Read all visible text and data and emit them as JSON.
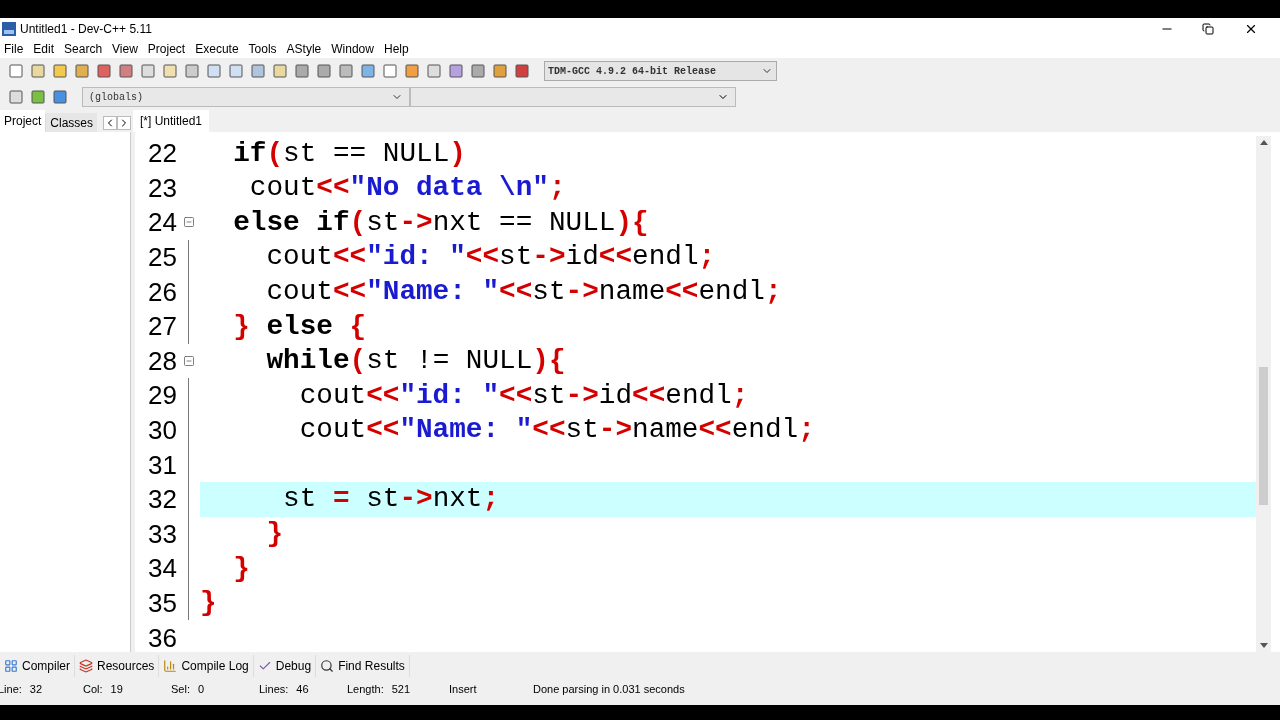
{
  "window": {
    "title": "Untitled1 - Dev-C++ 5.11"
  },
  "menu": [
    "File",
    "Edit",
    "Search",
    "View",
    "Project",
    "Execute",
    "Tools",
    "AStyle",
    "Window",
    "Help"
  ],
  "compiler_select": {
    "value": "TDM-GCC 4.9.2 64-bit Release"
  },
  "scope_select": {
    "value": "(globals)"
  },
  "side_tabs": [
    {
      "label": "Project",
      "selected": true
    },
    {
      "label": "Classes",
      "selected": false
    }
  ],
  "editor_tabs": [
    {
      "label": "[*] Untitled1",
      "selected": true
    }
  ],
  "lines": [
    {
      "number": "22",
      "fold": false,
      "current": false,
      "tokens": [
        {
          "kind": "keyword",
          "text": "  if"
        },
        {
          "kind": "operator",
          "text": "("
        },
        {
          "kind": "plain",
          "text": "st == NULL"
        },
        {
          "kind": "operator",
          "text": ")"
        }
      ]
    },
    {
      "number": "23",
      "fold": false,
      "current": false,
      "tokens": [
        {
          "kind": "plain",
          "text": "   cout"
        },
        {
          "kind": "operator",
          "text": "<<"
        },
        {
          "kind": "string",
          "text": "\"No data \\n\""
        },
        {
          "kind": "operator",
          "text": ";"
        }
      ]
    },
    {
      "number": "24",
      "fold": true,
      "current": false,
      "tokens": [
        {
          "kind": "keyword",
          "text": "  else if"
        },
        {
          "kind": "operator",
          "text": "("
        },
        {
          "kind": "plain",
          "text": "st"
        },
        {
          "kind": "operator",
          "text": "->"
        },
        {
          "kind": "plain",
          "text": "nxt == NULL"
        },
        {
          "kind": "operator",
          "text": "){"
        }
      ]
    },
    {
      "number": "25",
      "fold": false,
      "current": false,
      "tokens": [
        {
          "kind": "plain",
          "text": "    cout"
        },
        {
          "kind": "operator",
          "text": "<<"
        },
        {
          "kind": "string",
          "text": "\"id: \""
        },
        {
          "kind": "operator",
          "text": "<<"
        },
        {
          "kind": "plain",
          "text": "st"
        },
        {
          "kind": "operator",
          "text": "->"
        },
        {
          "kind": "plain",
          "text": "id"
        },
        {
          "kind": "operator",
          "text": "<<"
        },
        {
          "kind": "plain",
          "text": "endl"
        },
        {
          "kind": "operator",
          "text": ";"
        }
      ]
    },
    {
      "number": "26",
      "fold": false,
      "current": false,
      "tokens": [
        {
          "kind": "plain",
          "text": "    cout"
        },
        {
          "kind": "operator",
          "text": "<<"
        },
        {
          "kind": "string",
          "text": "\"Name: \""
        },
        {
          "kind": "operator",
          "text": "<<"
        },
        {
          "kind": "plain",
          "text": "st"
        },
        {
          "kind": "operator",
          "text": "->"
        },
        {
          "kind": "plain",
          "text": "name"
        },
        {
          "kind": "operator",
          "text": "<<"
        },
        {
          "kind": "plain",
          "text": "endl"
        },
        {
          "kind": "operator",
          "text": ";"
        }
      ]
    },
    {
      "number": "27",
      "fold": false,
      "current": false,
      "tokens": [
        {
          "kind": "operator",
          "text": "  }"
        },
        {
          "kind": "keyword",
          "text": " else "
        },
        {
          "kind": "operator",
          "text": "{"
        }
      ]
    },
    {
      "number": "28",
      "fold": true,
      "current": false,
      "tokens": [
        {
          "kind": "keyword",
          "text": "    while"
        },
        {
          "kind": "operator",
          "text": "("
        },
        {
          "kind": "plain",
          "text": "st != NULL"
        },
        {
          "kind": "operator",
          "text": "){"
        }
      ]
    },
    {
      "number": "29",
      "fold": false,
      "current": false,
      "tokens": [
        {
          "kind": "plain",
          "text": "      cout"
        },
        {
          "kind": "operator",
          "text": "<<"
        },
        {
          "kind": "string",
          "text": "\"id: \""
        },
        {
          "kind": "operator",
          "text": "<<"
        },
        {
          "kind": "plain",
          "text": "st"
        },
        {
          "kind": "operator",
          "text": "->"
        },
        {
          "kind": "plain",
          "text": "id"
        },
        {
          "kind": "operator",
          "text": "<<"
        },
        {
          "kind": "plain",
          "text": "endl"
        },
        {
          "kind": "operator",
          "text": ";"
        }
      ]
    },
    {
      "number": "30",
      "fold": false,
      "current": false,
      "tokens": [
        {
          "kind": "plain",
          "text": "      cout"
        },
        {
          "kind": "operator",
          "text": "<<"
        },
        {
          "kind": "string",
          "text": "\"Name: \""
        },
        {
          "kind": "operator",
          "text": "<<"
        },
        {
          "kind": "plain",
          "text": "st"
        },
        {
          "kind": "operator",
          "text": "->"
        },
        {
          "kind": "plain",
          "text": "name"
        },
        {
          "kind": "operator",
          "text": "<<"
        },
        {
          "kind": "plain",
          "text": "endl"
        },
        {
          "kind": "operator",
          "text": ";"
        }
      ]
    },
    {
      "number": "31",
      "fold": false,
      "current": false
    },
    {
      "number": "32",
      "fold": false,
      "current": true,
      "tokens": [
        {
          "kind": "plain",
          "text": "     st "
        },
        {
          "kind": "operator",
          "text": "="
        },
        {
          "kind": "plain",
          "text": " st"
        },
        {
          "kind": "operator",
          "text": "->"
        },
        {
          "kind": "plain",
          "text": "nxt"
        },
        {
          "kind": "operator",
          "text": ";"
        }
      ]
    },
    {
      "number": "33",
      "fold": false,
      "current": false,
      "tokens": [
        {
          "kind": "operator",
          "text": "    }"
        }
      ]
    },
    {
      "number": "34",
      "fold": false,
      "current": false,
      "tokens": [
        {
          "kind": "operator",
          "text": "  }"
        }
      ]
    },
    {
      "number": "35",
      "fold": false,
      "current": false,
      "tokens": [
        {
          "kind": "operator",
          "text": "}"
        }
      ]
    },
    {
      "number": "36",
      "fold": false,
      "current": false
    }
  ],
  "bottom_tabs": [
    {
      "label": "Compiler"
    },
    {
      "label": "Resources"
    },
    {
      "label": "Compile Log"
    },
    {
      "label": "Debug"
    },
    {
      "label": "Find Results"
    }
  ],
  "status_bar": [
    {
      "label": "Line:",
      "value": "32"
    },
    {
      "label": "Col:",
      "value": "19"
    },
    {
      "label": "Sel:",
      "value": "0"
    },
    {
      "label": "Lines:",
      "value": "46"
    },
    {
      "label": "Length:",
      "value": "521"
    }
  ],
  "status_mode": "Insert",
  "status_message": "Done parsing in 0.031 seconds"
}
